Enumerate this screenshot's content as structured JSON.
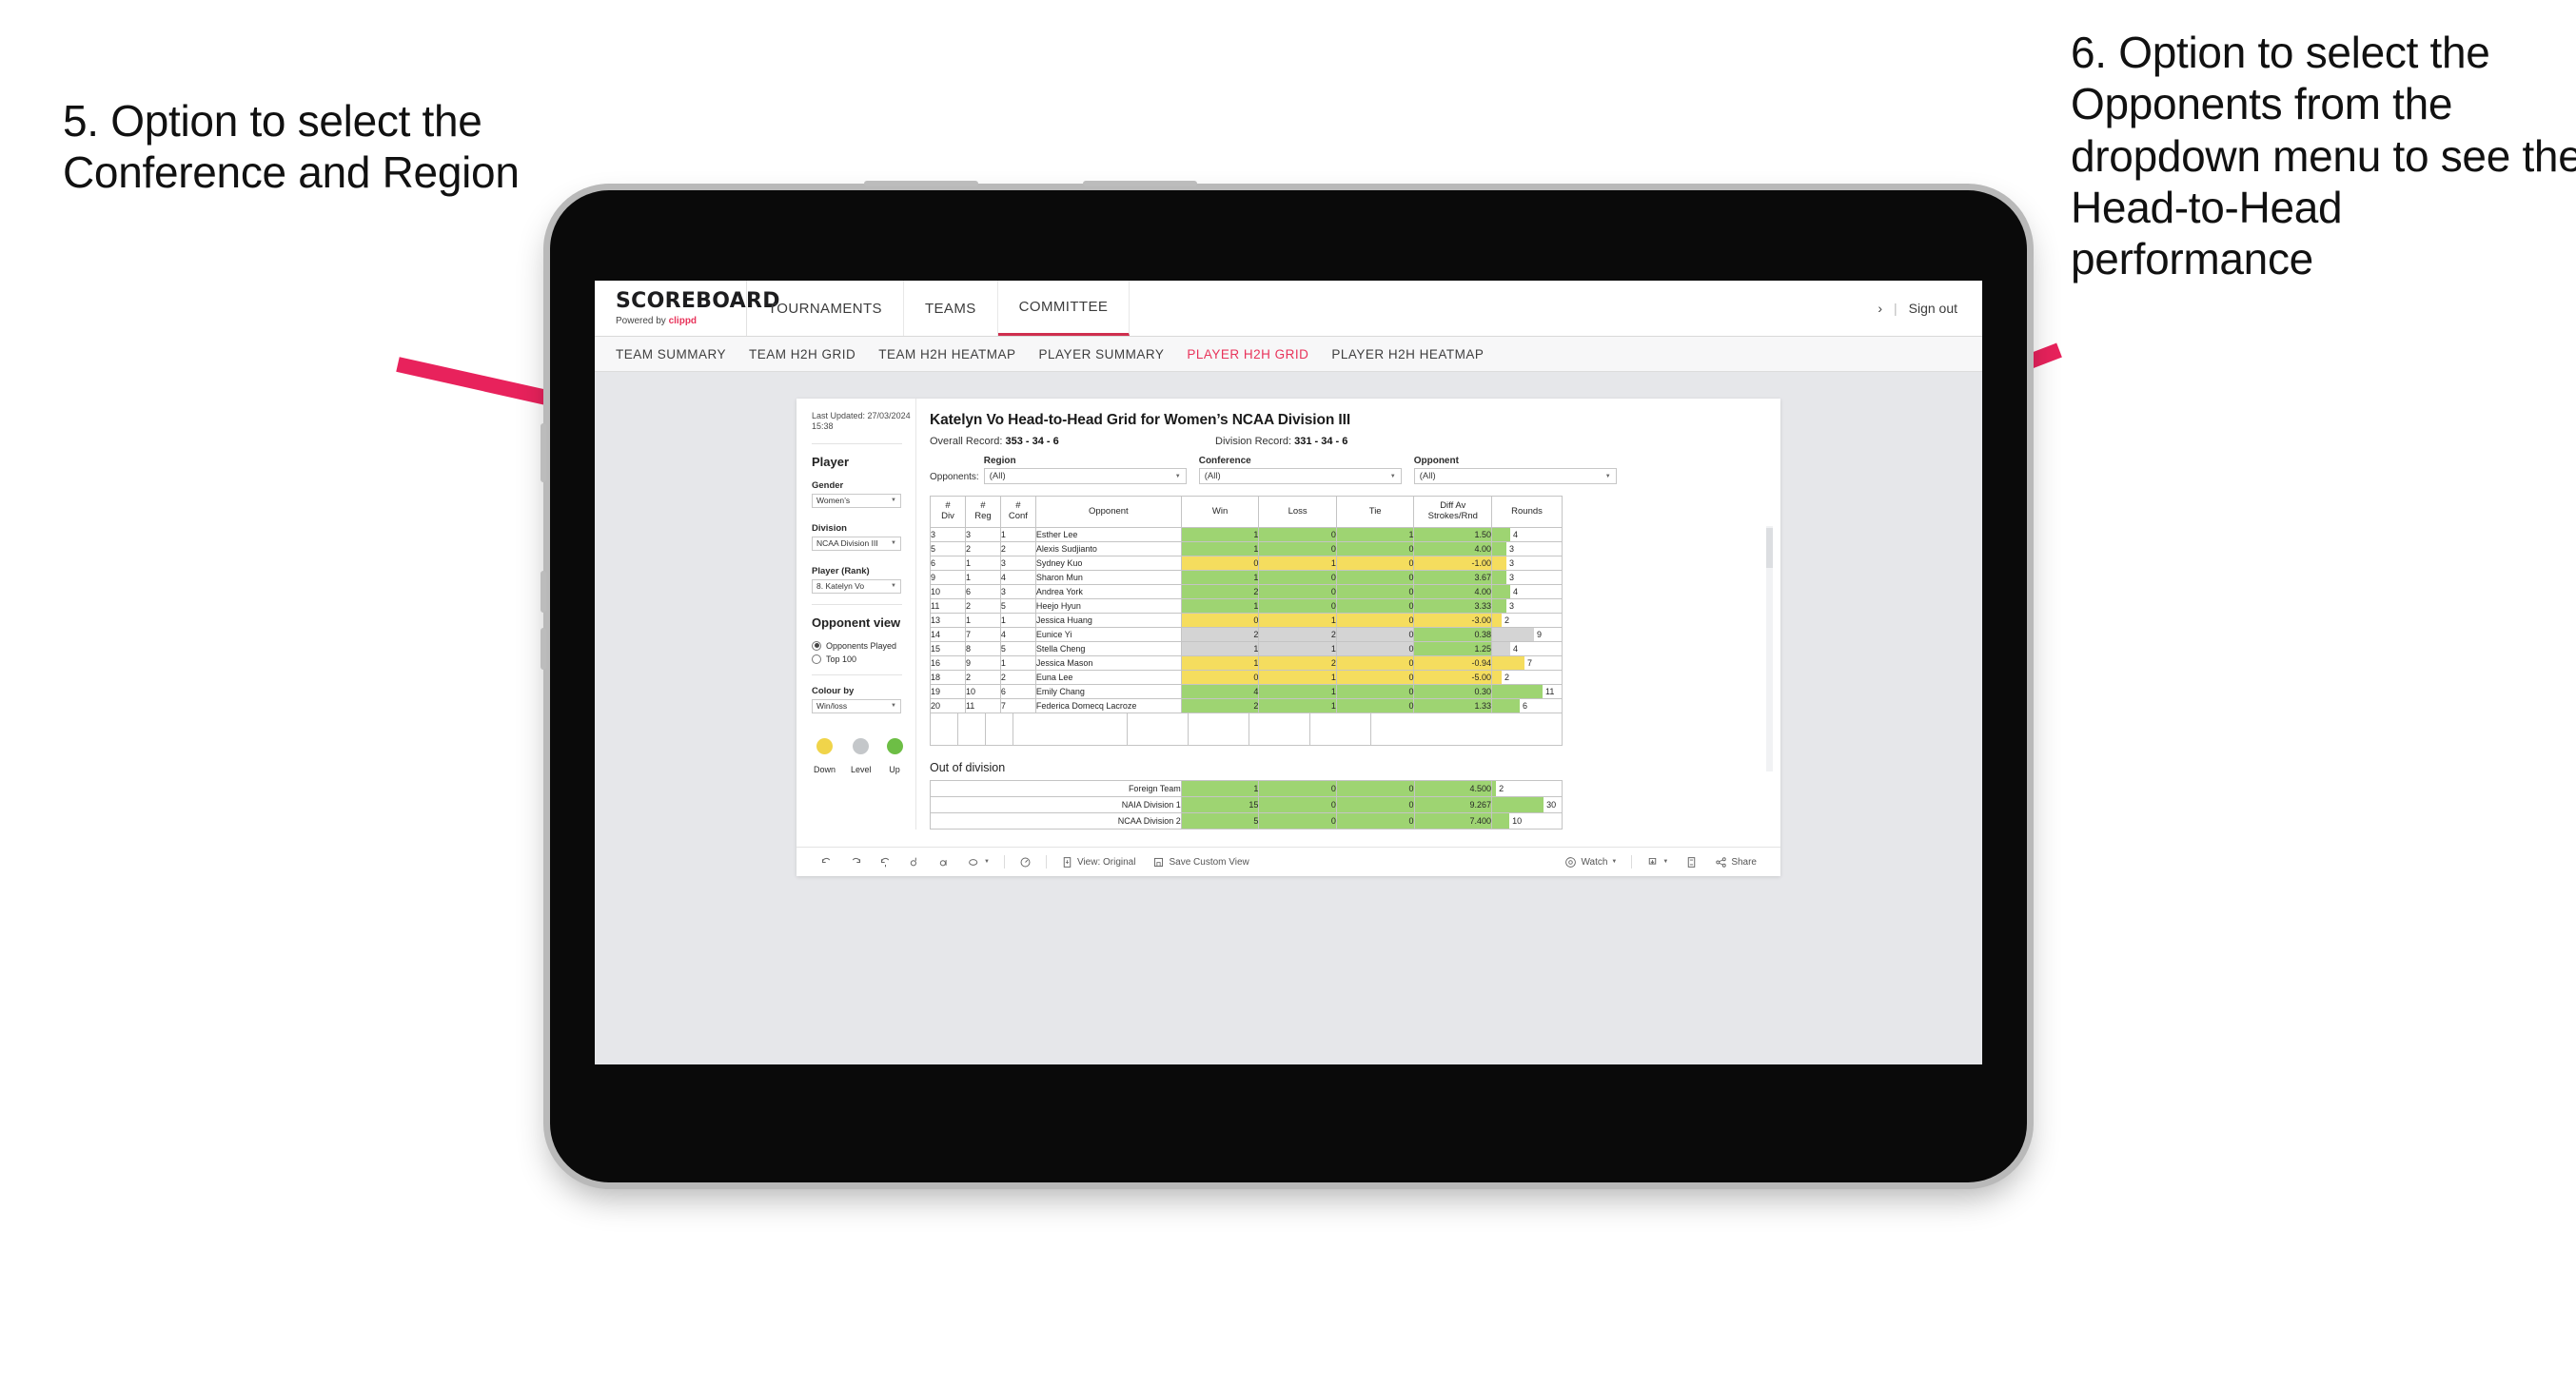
{
  "annotations": {
    "left": "5. Option to select the Conference and Region",
    "right": "6. Option to select the Opponents from the dropdown menu to see the Head-to-Head performance",
    "arrow_color": "#e8225c"
  },
  "app": {
    "brand": {
      "title": "SCOREBOARD",
      "powered_prefix": "Powered by ",
      "powered_brand": "clippd"
    },
    "nav": [
      {
        "label": "TOURNAMENTS",
        "active": false
      },
      {
        "label": "TEAMS",
        "active": false
      },
      {
        "label": "COMMITTEE",
        "active": true
      }
    ],
    "header_right": {
      "chevron": "›",
      "separator": "|",
      "sign_out": "Sign out"
    },
    "subnav": [
      {
        "label": "TEAM SUMMARY",
        "active": false
      },
      {
        "label": "TEAM H2H GRID",
        "active": false
      },
      {
        "label": "TEAM H2H HEATMAP",
        "active": false
      },
      {
        "label": "PLAYER SUMMARY",
        "active": false
      },
      {
        "label": "PLAYER H2H GRID",
        "active": true
      },
      {
        "label": "PLAYER H2H HEATMAP",
        "active": false
      }
    ]
  },
  "sidebar": {
    "last_updated": "Last Updated: 27/03/2024 15:38",
    "player_heading": "Player",
    "gender": {
      "label": "Gender",
      "value": "Women’s"
    },
    "division": {
      "label": "Division",
      "value": "NCAA Division III"
    },
    "player_rank": {
      "label": "Player (Rank)",
      "value": "8. Katelyn Vo"
    },
    "opponent_view": {
      "heading": "Opponent view",
      "options": [
        {
          "label": "Opponents Played",
          "selected": true
        },
        {
          "label": "Top 100",
          "selected": false
        }
      ]
    },
    "colour_by": {
      "label": "Colour by",
      "value": "Win/loss"
    },
    "legend": [
      {
        "label": "Down",
        "color": "#f0d44a"
      },
      {
        "label": "Level",
        "color": "#c4c7ca"
      },
      {
        "label": "Up",
        "color": "#6dbe45"
      }
    ]
  },
  "main": {
    "title": "Katelyn Vo Head-to-Head Grid for Women’s NCAA Division III",
    "overall_record_label": "Overall Record: ",
    "overall_record_value": "353 -  34 - 6",
    "division_record_label": "Division Record: ",
    "division_record_value": "331 -  34 - 6",
    "opponents_label": "Opponents:",
    "filters": [
      {
        "label": "Region",
        "value": "(All)"
      },
      {
        "label": "Conference",
        "value": "(All)"
      },
      {
        "label": "Opponent",
        "value": "(All)"
      }
    ],
    "out_of_division_heading": "Out of division"
  },
  "chart_data": {
    "type": "table",
    "title": "Katelyn Vo Head-to-Head Grid for Women’s NCAA Division III",
    "columns": [
      "# Div",
      "# Reg",
      "# Conf",
      "Opponent",
      "Win",
      "Loss",
      "Tie",
      "Diff Av Strokes/Rnd",
      "Rounds"
    ],
    "header_lines": [
      [
        "#",
        "Div"
      ],
      [
        "#",
        "Reg"
      ],
      [
        "#",
        "Conf"
      ],
      [
        "Opponent",
        ""
      ],
      [
        "Win",
        ""
      ],
      [
        "Loss",
        ""
      ],
      [
        "Tie",
        ""
      ],
      [
        "Diff Av",
        "Strokes/Rnd"
      ],
      [
        "Rounds",
        ""
      ]
    ],
    "colour_scale": {
      "up": "#9ed472",
      "level": "#d4d4d4",
      "down": "#f5dd5e"
    },
    "rounds_max": 12,
    "rows": [
      {
        "div": "3",
        "reg": "3",
        "conf": "1",
        "opponent": "Esther Lee",
        "win": "1",
        "loss": "0",
        "tie": "1",
        "diff": "1.50",
        "rounds": "4",
        "state": "up"
      },
      {
        "div": "5",
        "reg": "2",
        "conf": "2",
        "opponent": "Alexis Sudjianto",
        "win": "1",
        "loss": "0",
        "tie": "0",
        "diff": "4.00",
        "rounds": "3",
        "state": "up"
      },
      {
        "div": "6",
        "reg": "1",
        "conf": "3",
        "opponent": "Sydney Kuo",
        "win": "0",
        "loss": "1",
        "tie": "0",
        "diff": "-1.00",
        "rounds": "3",
        "state": "down"
      },
      {
        "div": "9",
        "reg": "1",
        "conf": "4",
        "opponent": "Sharon Mun",
        "win": "1",
        "loss": "0",
        "tie": "0",
        "diff": "3.67",
        "rounds": "3",
        "state": "up"
      },
      {
        "div": "10",
        "reg": "6",
        "conf": "3",
        "opponent": "Andrea York",
        "win": "2",
        "loss": "0",
        "tie": "0",
        "diff": "4.00",
        "rounds": "4",
        "state": "up"
      },
      {
        "div": "11",
        "reg": "2",
        "conf": "5",
        "opponent": "Heejo Hyun",
        "win": "1",
        "loss": "0",
        "tie": "0",
        "diff": "3.33",
        "rounds": "3",
        "state": "up"
      },
      {
        "div": "13",
        "reg": "1",
        "conf": "1",
        "opponent": "Jessica Huang",
        "win": "0",
        "loss": "1",
        "tie": "0",
        "diff": "-3.00",
        "rounds": "2",
        "state": "down"
      },
      {
        "div": "14",
        "reg": "7",
        "conf": "4",
        "opponent": "Eunice Yi",
        "win": "2",
        "loss": "2",
        "tie": "0",
        "diff": "0.38",
        "rounds": "9",
        "state": "level",
        "diff_state": "up"
      },
      {
        "div": "15",
        "reg": "8",
        "conf": "5",
        "opponent": "Stella Cheng",
        "win": "1",
        "loss": "1",
        "tie": "0",
        "diff": "1.25",
        "rounds": "4",
        "state": "level",
        "diff_state": "up"
      },
      {
        "div": "16",
        "reg": "9",
        "conf": "1",
        "opponent": "Jessica Mason",
        "win": "1",
        "loss": "2",
        "tie": "0",
        "diff": "-0.94",
        "rounds": "7",
        "state": "down"
      },
      {
        "div": "18",
        "reg": "2",
        "conf": "2",
        "opponent": "Euna Lee",
        "win": "0",
        "loss": "1",
        "tie": "0",
        "diff": "-5.00",
        "rounds": "2",
        "state": "down"
      },
      {
        "div": "19",
        "reg": "10",
        "conf": "6",
        "opponent": "Emily Chang",
        "win": "4",
        "loss": "1",
        "tie": "0",
        "diff": "0.30",
        "rounds": "11",
        "state": "up"
      },
      {
        "div": "20",
        "reg": "11",
        "conf": "7",
        "opponent": "Federica Domecq Lacroze",
        "win": "2",
        "loss": "1",
        "tie": "0",
        "diff": "1.33",
        "rounds": "6",
        "state": "up"
      }
    ],
    "out_of_division": {
      "rounds_max": 32,
      "rows": [
        {
          "name": "Foreign Team",
          "win": "1",
          "loss": "0",
          "tie": "0",
          "diff": "4.500",
          "rounds": "2",
          "state": "up"
        },
        {
          "name": "NAIA Division 1",
          "win": "15",
          "loss": "0",
          "tie": "0",
          "diff": "9.267",
          "rounds": "30",
          "state": "up"
        },
        {
          "name": "NCAA Division 2",
          "win": "5",
          "loss": "0",
          "tie": "0",
          "diff": "7.400",
          "rounds": "10",
          "state": "up"
        }
      ]
    }
  },
  "toolbar": {
    "view_original": "View: Original",
    "save_custom_view": "Save Custom View",
    "watch": "Watch",
    "share": "Share"
  }
}
